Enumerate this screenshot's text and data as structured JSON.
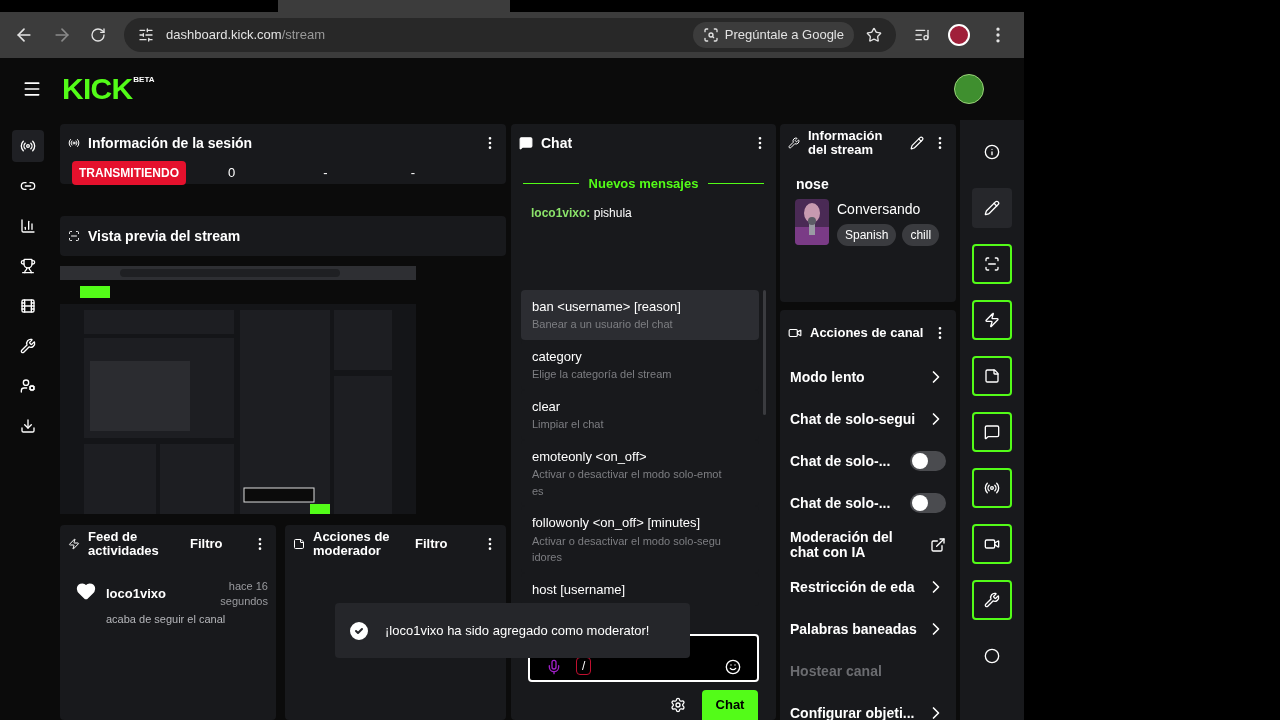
{
  "browser": {
    "url_host": "dashboard.kick.com",
    "url_path": "/stream",
    "ask_google": "Pregúntale a Google"
  },
  "header": {
    "logo": "KICK",
    "badge": "BETA"
  },
  "left_nav": [
    {
      "selected": true
    },
    {
      "selected": false
    },
    {
      "selected": false
    },
    {
      "selected": false
    },
    {
      "selected": false
    },
    {
      "selected": false
    },
    {
      "selected": false
    },
    {
      "selected": false
    }
  ],
  "session": {
    "title": "Información de la sesión",
    "status": "TRANSMITIENDO",
    "stats": [
      "0",
      "-",
      "-"
    ]
  },
  "preview": {
    "title": "Vista previa del stream"
  },
  "feed": {
    "title": "Feed de actividades",
    "filter": "Filtro",
    "items": [
      {
        "user": "loco1vixo",
        "time": "hace 16 segundos",
        "text": "acaba de seguir el canal"
      }
    ]
  },
  "mod_actions": {
    "title": "Acciones de moderador",
    "filter": "Filtro"
  },
  "chat": {
    "title": "Chat",
    "divider": "Nuevos mensajes",
    "messages": [
      {
        "user": "loco1vixo:",
        "text": "pishula"
      }
    ],
    "commands": [
      {
        "name": "ban <username> [reason]",
        "desc": "Banear a un usuario del chat",
        "selected": true
      },
      {
        "name": "category",
        "desc": "Elige la categoría del stream",
        "selected": false
      },
      {
        "name": "clear",
        "desc": "Limpiar el chat",
        "selected": false
      },
      {
        "name": "emoteonly <on_off>",
        "desc": "Activar o desactivar el modo solo-emotes",
        "selected": false
      },
      {
        "name": "followonly <on_off> [minutes]",
        "desc": "Activar o desactivar el modo solo-seguidores",
        "selected": false
      },
      {
        "name": "host [username]",
        "selected": false
      }
    ],
    "input_value": "/",
    "send": "Chat"
  },
  "stream_info": {
    "title": "Información del stream",
    "stream_title": "nose",
    "category": "Conversando",
    "tags": [
      "Spanish",
      "chill"
    ]
  },
  "channel_actions": {
    "title": "Acciones de canal",
    "items": [
      {
        "kind": "link",
        "label": "Modo lento"
      },
      {
        "kind": "link",
        "label": "Chat de solo-segui"
      },
      {
        "kind": "toggle",
        "label": "Chat de solo-...",
        "on": false
      },
      {
        "kind": "toggle",
        "label": "Chat de solo-...",
        "on": false
      },
      {
        "kind": "external",
        "label": "Moderación del chat con IA"
      },
      {
        "kind": "link",
        "label": "Restricción de eda"
      },
      {
        "kind": "link",
        "label": "Palabras baneadas"
      },
      {
        "kind": "disabled",
        "label": "Hostear canal"
      },
      {
        "kind": "link",
        "label": "Configurar objeti..."
      }
    ]
  },
  "right_rail": [
    {
      "outlined": false,
      "selected": false
    },
    {
      "outlined": false,
      "selected": true
    },
    {
      "outlined": true,
      "selected": false
    },
    {
      "outlined": true,
      "selected": false
    },
    {
      "outlined": true,
      "selected": false
    },
    {
      "outlined": true,
      "selected": false
    },
    {
      "outlined": true,
      "selected": false
    },
    {
      "outlined": true,
      "selected": false
    },
    {
      "outlined": true,
      "selected": false
    },
    {
      "outlined": false,
      "selected": false
    }
  ],
  "toast": {
    "text": "¡loco1vixo ha sido agregado como moderator!"
  }
}
